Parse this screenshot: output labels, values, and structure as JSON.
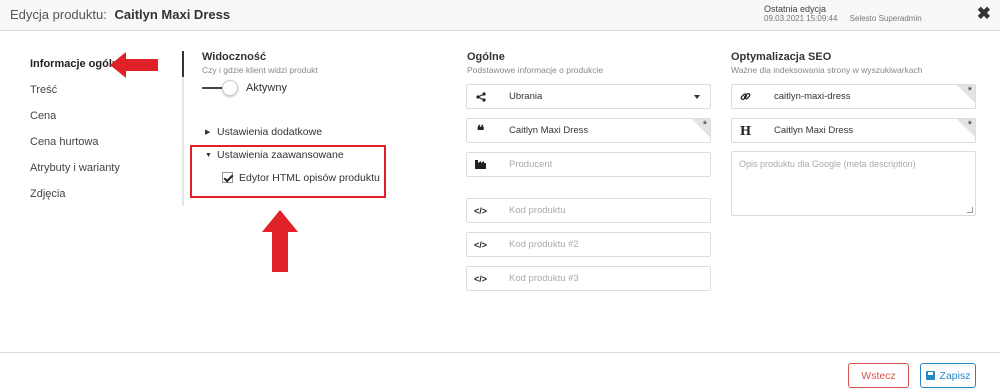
{
  "header": {
    "title_prefix": "Edycja produktu:",
    "product_name": "Caitlyn Maxi Dress",
    "last_edit_label": "Ostatnia edycja",
    "last_edit_date": "09.03.2021",
    "last_edit_time": "15:09:44",
    "last_edit_user": "Selesto Superadmin",
    "close_icon": "close-icon"
  },
  "nav": {
    "items": [
      {
        "label": "Informacje ogólne",
        "active": true
      },
      {
        "label": "Treść"
      },
      {
        "label": "Cena"
      },
      {
        "label": "Cena hurtowa"
      },
      {
        "label": "Atrybuty i warianty"
      },
      {
        "label": "Zdjęcia"
      }
    ]
  },
  "visibility": {
    "title": "Widoczność",
    "subtitle": "Czy i gdzie klient widzi produkt",
    "toggle_label": "Aktywny",
    "toggle_on": true
  },
  "expanders": {
    "additional": "Ustawienia dodatkowe",
    "advanced": "Ustawienia zaawansowane",
    "html_editor_label": "Edytor HTML opisów produktu",
    "html_editor_checked": true
  },
  "general": {
    "title": "Ogólne",
    "subtitle": "Podstawowe informacje o produkcie",
    "category_value": "Ubrania",
    "name_value": "Caitlyn Maxi Dress",
    "producer_placeholder": "Producent",
    "code_placeholder": "Kod produktu",
    "code2_placeholder": "Kod produktu #2",
    "code3_placeholder": "Kod produktu #3"
  },
  "seo": {
    "title": "Optymalizacja SEO",
    "subtitle": "Ważne dla indeksowania strony w wyszukiwarkach",
    "slug_value": "caitlyn-maxi-dress",
    "heading_value": "Caitlyn Maxi Dress",
    "meta_placeholder": "Opis produktu dla Google (meta description)"
  },
  "footer": {
    "back_label": "Wstecz",
    "save_label": "Zapisz"
  },
  "colors": {
    "annotation_red": "#e02128",
    "back_red": "#d9534f",
    "save_blue": "#2a87c4"
  },
  "required_mark": "*"
}
